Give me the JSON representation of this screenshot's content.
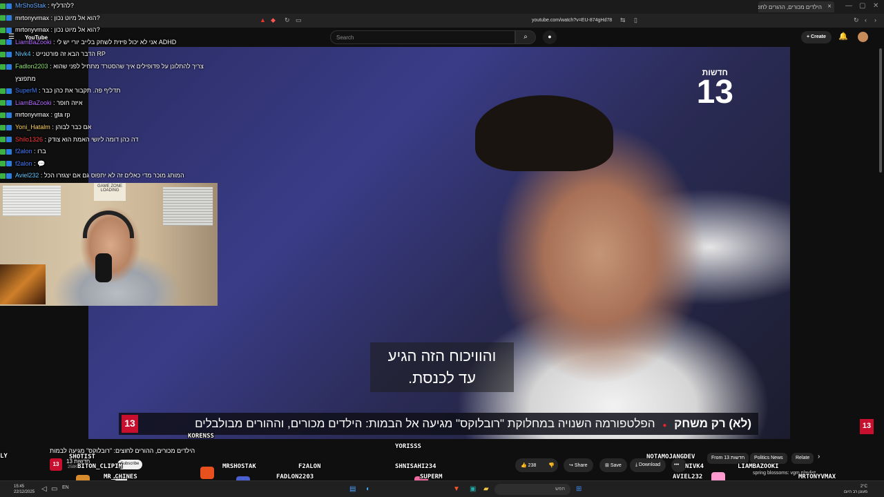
{
  "browser": {
    "tab_title": "הילדים מכורים, ההורים לחוצים",
    "url": "youtube.com/watch?v=EU-874gHd78",
    "tab_close": "×",
    "new_tab": "+",
    "minimize": "—",
    "maximize": "▢",
    "close": "✕"
  },
  "youtube": {
    "logo_text": "YouTube",
    "search_placeholder": "Search",
    "create_label": "Create"
  },
  "video": {
    "channel_logo_top": "חדשות",
    "channel_logo_number": "13",
    "subtitle_line1": "והוויכוח הזה הגיע",
    "subtitle_line2": "עד לכנסת.",
    "ticker_label": "(לא) רק משחק",
    "ticker_text": "הפלטפורמה השנויה במחלוקת \"רובלוקס\" מגיעה אל הבמות: הילדים מכורים, וההורים מבולבלים",
    "ticker_logo": "13",
    "watermark": "13"
  },
  "chat": [
    {
      "user": "MrShoStak",
      "color": "#5fa8ff",
      "msg": ": להדליף?"
    },
    {
      "user": "mrtonyvmax",
      "color": "#ffffff",
      "msg": ": הוא אל מיוט נכון?"
    },
    {
      "user": "mrtonyvmax",
      "color": "#ffffff",
      "msg": ": הוא אל מיוט נכון?"
    },
    {
      "user": "LiamBaZooki",
      "color": "#b36bff",
      "msg": ": אני לא יכול פיזית לשחק בלייב יורי יש לי ADHD"
    },
    {
      "user": "Nivk4",
      "color": "#5fc7ff",
      "msg": ": הדבר הבא זה פורטנייט RP"
    },
    {
      "user": "Fadlon2203",
      "color": "#8fe36a",
      "msg": ": צריך להתלונן על פדופילים איך שהסטרד מתחיל לפני שהוא"
    },
    {
      "user": "",
      "color": "#ffffff",
      "msg": "מתפוצץ"
    },
    {
      "user": "SuperM",
      "color": "#3d7dff",
      "msg": ": תדליף פה. תקבור את כהן כבר"
    },
    {
      "user": "LiamBaZooki",
      "color": "#b36bff",
      "msg": ": איזה חופר"
    },
    {
      "user": "mrtonyvmax",
      "color": "#ffffff",
      "msg": ": gta rp"
    },
    {
      "user": "Yoni_Hatalm",
      "color": "#ffd45c",
      "msg": ": אם כבר לבוהן"
    },
    {
      "user": "Shilo1326",
      "color": "#ff3b3b",
      "msg": ": דה כהן דומה ליושי האמת הוא צודק"
    },
    {
      "user": "f2alon",
      "color": "#3d7dff",
      "msg": ": ברו"
    },
    {
      "user": "f2alon",
      "color": "#3d7dff",
      "msg": ": 💬"
    },
    {
      "user": "Aviel232",
      "color": "#5fc7ff",
      "msg": ": המותג מוכר מדי כאלים זה לא יתפוס גם אם יצגזרו הכל"
    }
  ],
  "webcam": {
    "game_zone_label": "GAME ZONE",
    "game_zone_sub": "LOADING"
  },
  "below": {
    "video_title": "הילדים מכורים, ההורים לחוצים: \"רובלוקס\" מגיעה לבמות",
    "channel_logo": "13",
    "channel_name": "חדשות 13",
    "subs": "258K",
    "subscribe_label": "Subscribe",
    "likes": "238",
    "share_label": "Share",
    "save_label": "Save",
    "download_label": "Download",
    "more_label": "•••",
    "chips": [
      "From 13 חדשות",
      "Politics News",
      "Relate"
    ],
    "rec_title": "spring blossoms: vgm playlist"
  },
  "game_names": [
    {
      "name": "LY"
    },
    {
      "name": "SHOTIST"
    },
    {
      "name": "BITON_CLIPIM"
    },
    {
      "name": "MR_CHINES"
    },
    {
      "name": "KORENSS"
    },
    {
      "name": "MRSHOSTAK"
    },
    {
      "name": "F2ALON"
    },
    {
      "name": "FADLON2203"
    },
    {
      "name": "YORISSS"
    },
    {
      "name": "SHNISAHI234"
    },
    {
      "name": "SUPERM"
    },
    {
      "name": "NOTAMOJANGDEV"
    },
    {
      "name": "NIVK4"
    },
    {
      "name": "LIAMBAZOOKI"
    },
    {
      "name": "AVIEL232"
    },
    {
      "name": "MRTONYVMAX"
    }
  ],
  "taskbar": {
    "time": "15:45",
    "date": "22/12/2025",
    "lang": "EN",
    "search_placeholder": "חפש",
    "temp": "2°C",
    "weather_text": "מעונן רב היום"
  }
}
